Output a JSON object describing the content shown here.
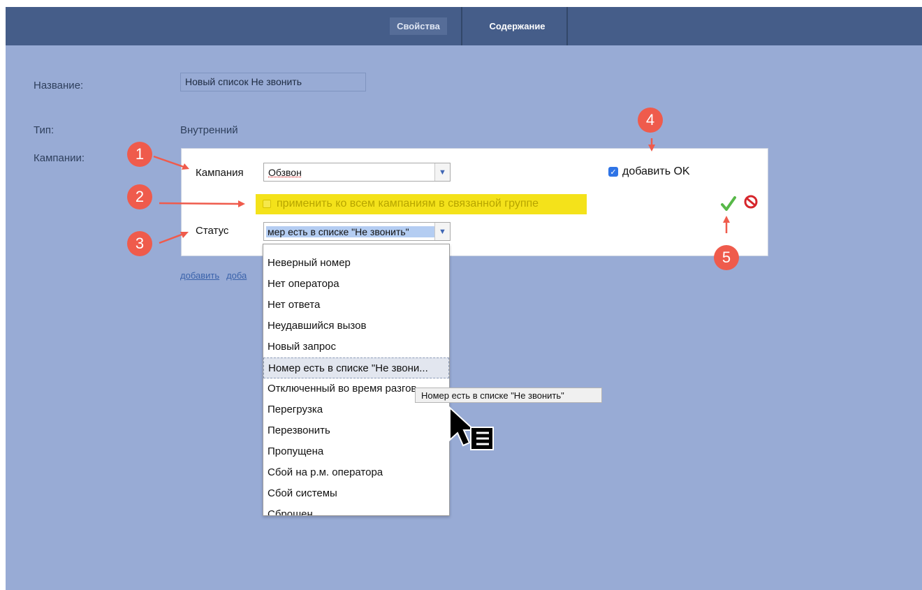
{
  "tabs": [
    {
      "label": "Свойства",
      "active": true
    },
    {
      "label": "Содержание",
      "active": false
    }
  ],
  "form": {
    "name_label": "Название:",
    "name_value": "Новый список Не звонить",
    "type_label": "Тип:",
    "type_value": "Внутренний",
    "campaigns_label": "Кампании:"
  },
  "panel": {
    "campaign_label": "Кампания",
    "campaign_value": "Обзвон",
    "apply_all_label": "применить ко всем кампаниям в связанной группе",
    "apply_all_checked": false,
    "status_label": "Статус",
    "status_value": "мер есть в списке \"Не звонить\"",
    "add_ok_label": "добавить OK",
    "add_ok_checked": true
  },
  "links": [
    "добавить",
    "доба"
  ],
  "status_options": [
    "Неверный номер",
    "Нет оператора",
    "Нет ответа",
    "Неудавшийся вызов",
    "Новый запрос",
    "Номер есть в списке \"Не звони...",
    "Отключенный во время разгов",
    "Перегрузка",
    "Перезвонить",
    "Пропущена",
    "Сбой на р.м. оператора",
    "Сбой системы",
    "Сброшен"
  ],
  "selected_option_index": 5,
  "tooltip": "Номер есть в списке \"Не звонить\"",
  "badges": [
    "1",
    "2",
    "3",
    "4",
    "5"
  ],
  "colors": {
    "background": "#98abd5",
    "header": "#455d89",
    "highlight": "#f4e21a",
    "badge": "#ef5b4c",
    "check_ok": "#57b848",
    "cancel": "#d6262c"
  },
  "icons": [
    "chevron-down-icon",
    "checkmark-icon",
    "cancel-icon",
    "cursor-icon"
  ]
}
